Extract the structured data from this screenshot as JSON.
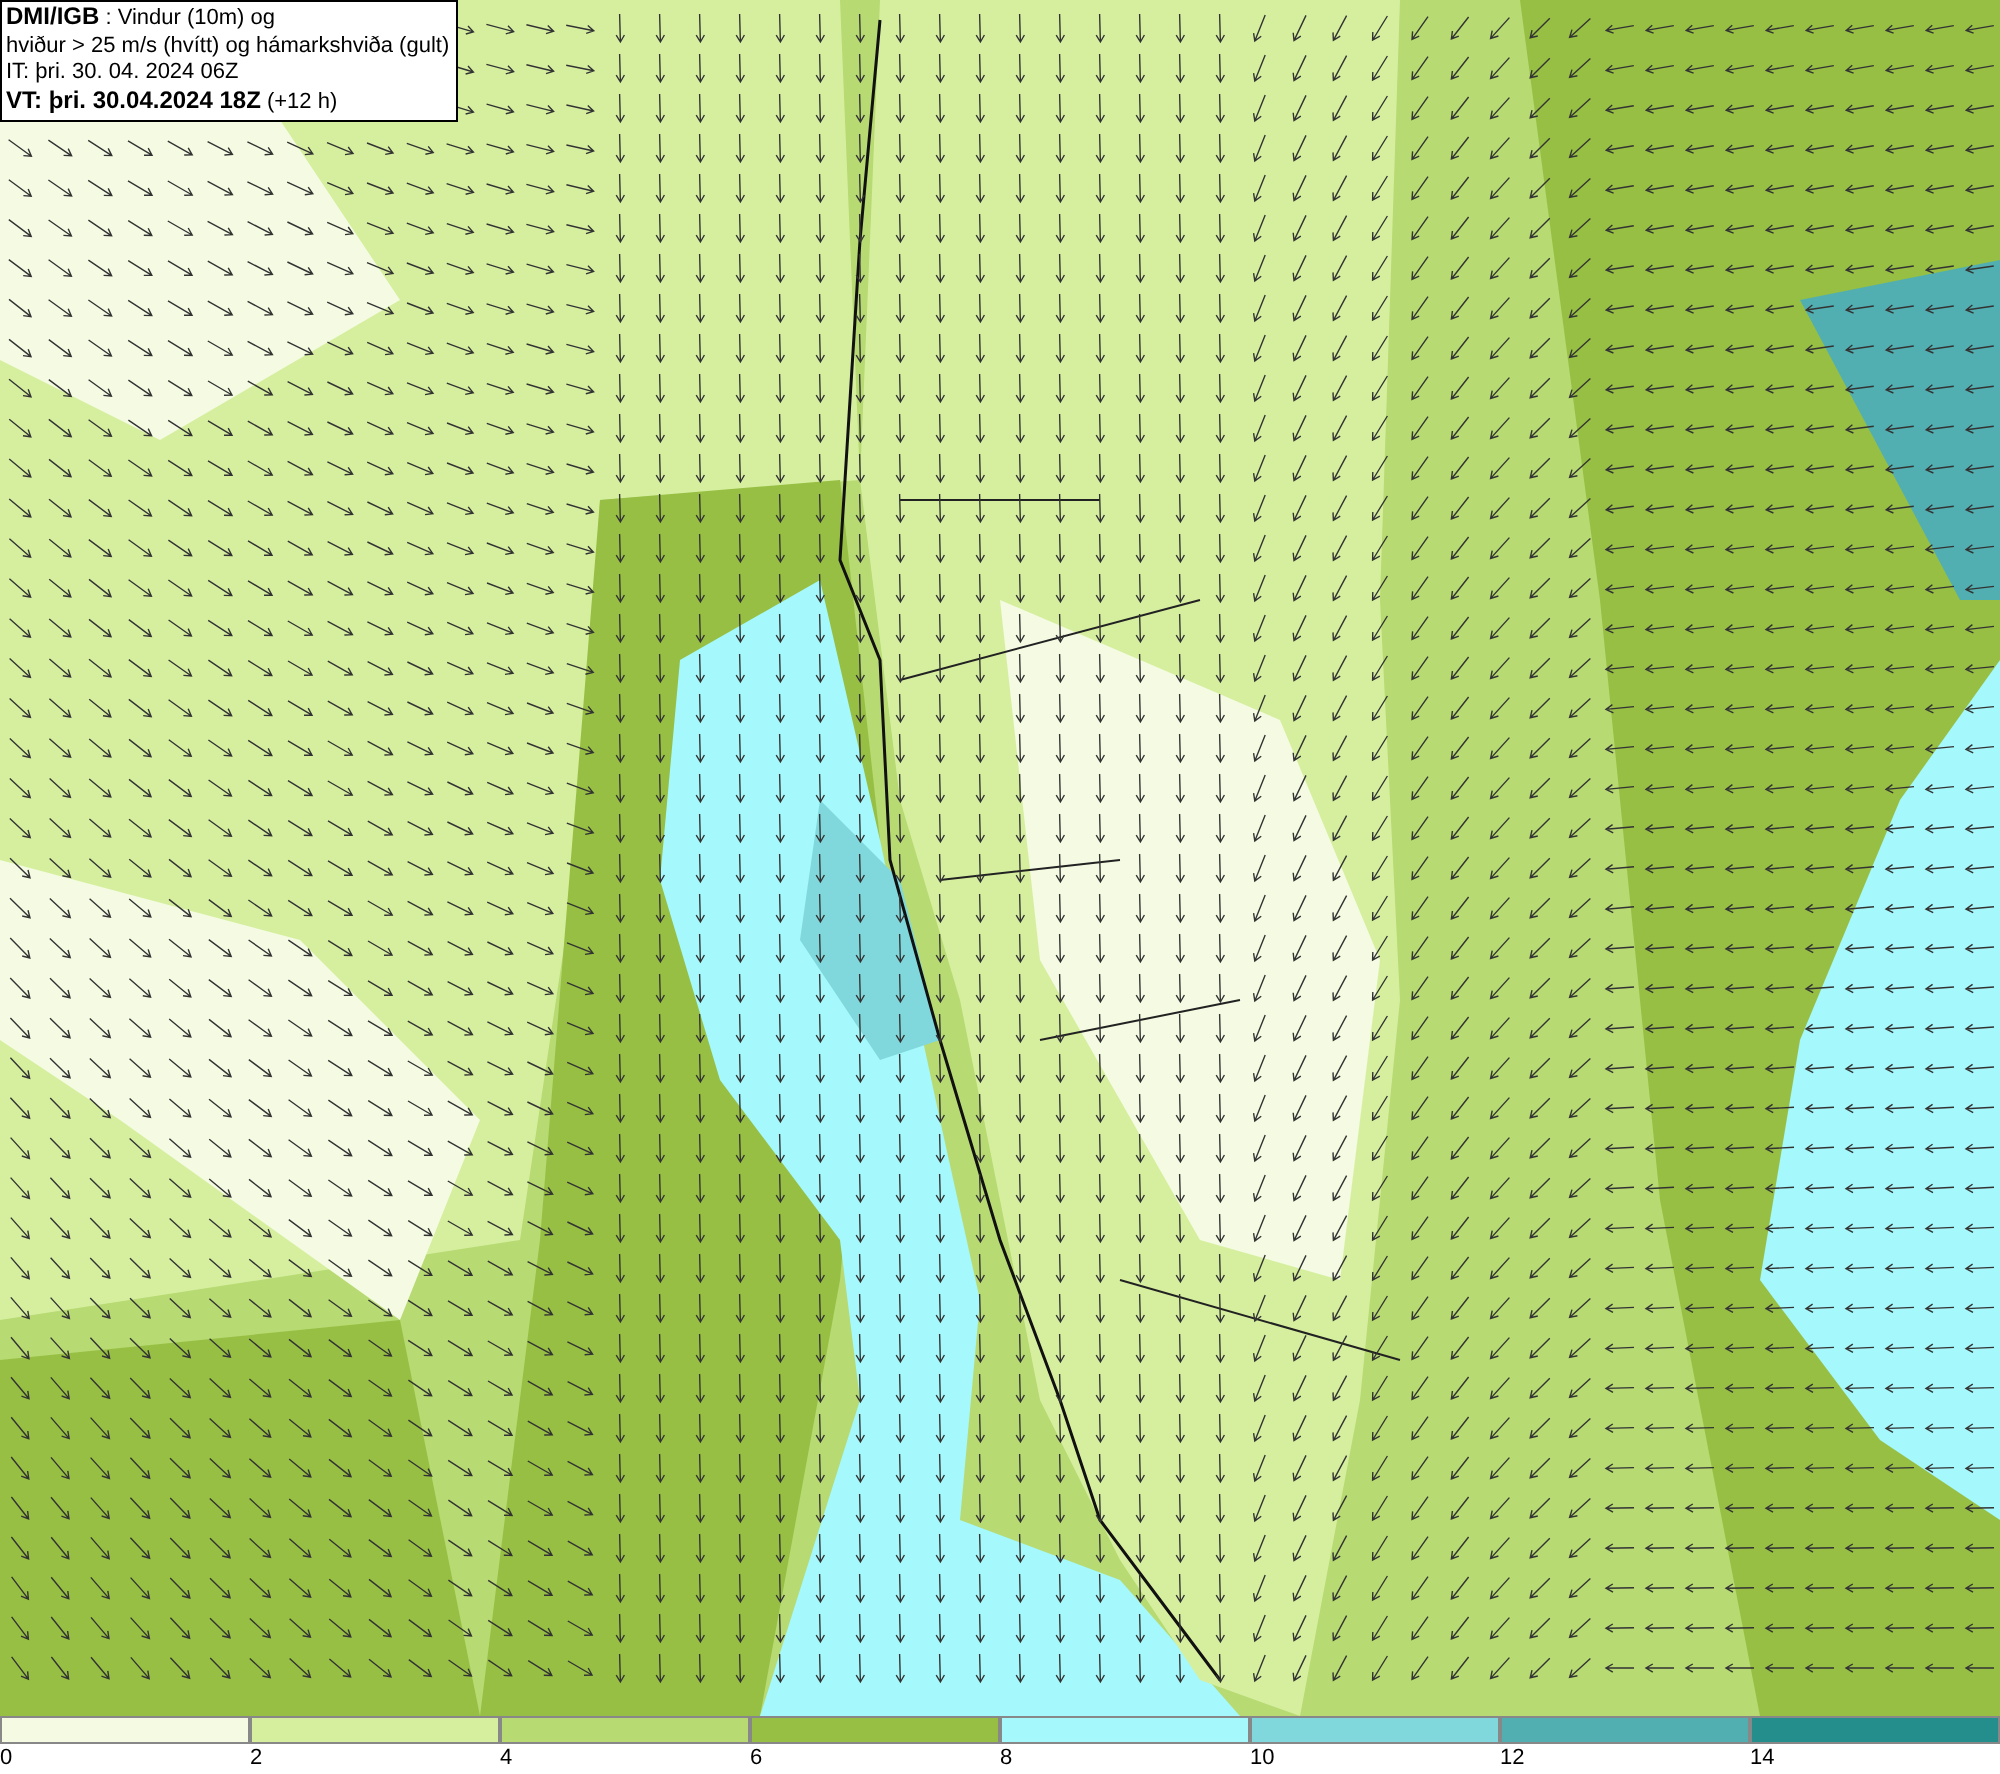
{
  "header": {
    "lines": [
      "**DMI/IGB** : Vindur (10m) og",
      "hviður > 25 m/s (hvítt) og hámarkshviða (gult)",
      "IT: þri. 30. 04. 2024 06Z",
      "**VT: þri. 30.04.2024 18Z** (+12 h)"
    ]
  },
  "legend": {
    "bins": [
      {
        "color": "#f4fbe2",
        "label": "0"
      },
      {
        "color": "#d6ef9f",
        "label": "2"
      },
      {
        "color": "#b7da72",
        "label": "4"
      },
      {
        "color": "#97bf44",
        "label": "6"
      },
      {
        "color": "#a5f8fb",
        "label": "8"
      },
      {
        "color": "#80d8dc",
        "label": "10"
      },
      {
        "color": "#51afb1",
        "label": "12"
      },
      {
        "color": "#238e8b",
        "label": "14"
      }
    ]
  }
}
